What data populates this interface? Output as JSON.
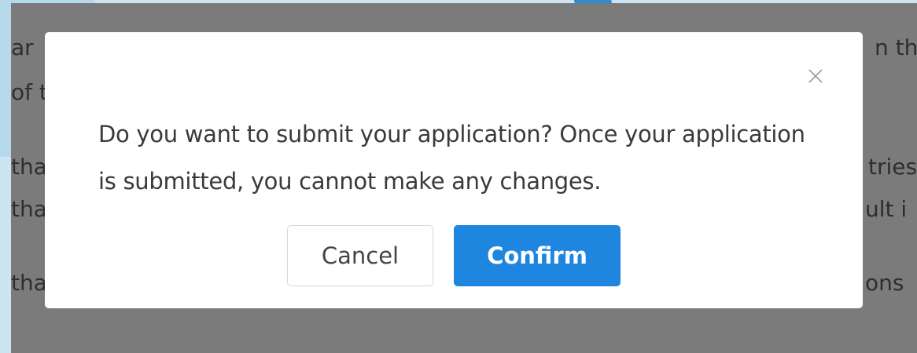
{
  "background": {
    "visible_fragments": {
      "left": [
        "ar",
        "of t",
        "tha",
        "tha",
        "tha"
      ],
      "right": [
        "n th",
        "tries",
        "ult i",
        "ons"
      ]
    }
  },
  "dialog": {
    "message": "Do you want to submit your application? Once your application is submitted, you cannot make any changes.",
    "cancel_label": "Cancel",
    "confirm_label": "Confirm",
    "close_icon": "close-icon"
  },
  "colors": {
    "primary": "#1f86e0",
    "overlay": "#7b7b7b",
    "frame_accent": "#2a8fd0"
  }
}
